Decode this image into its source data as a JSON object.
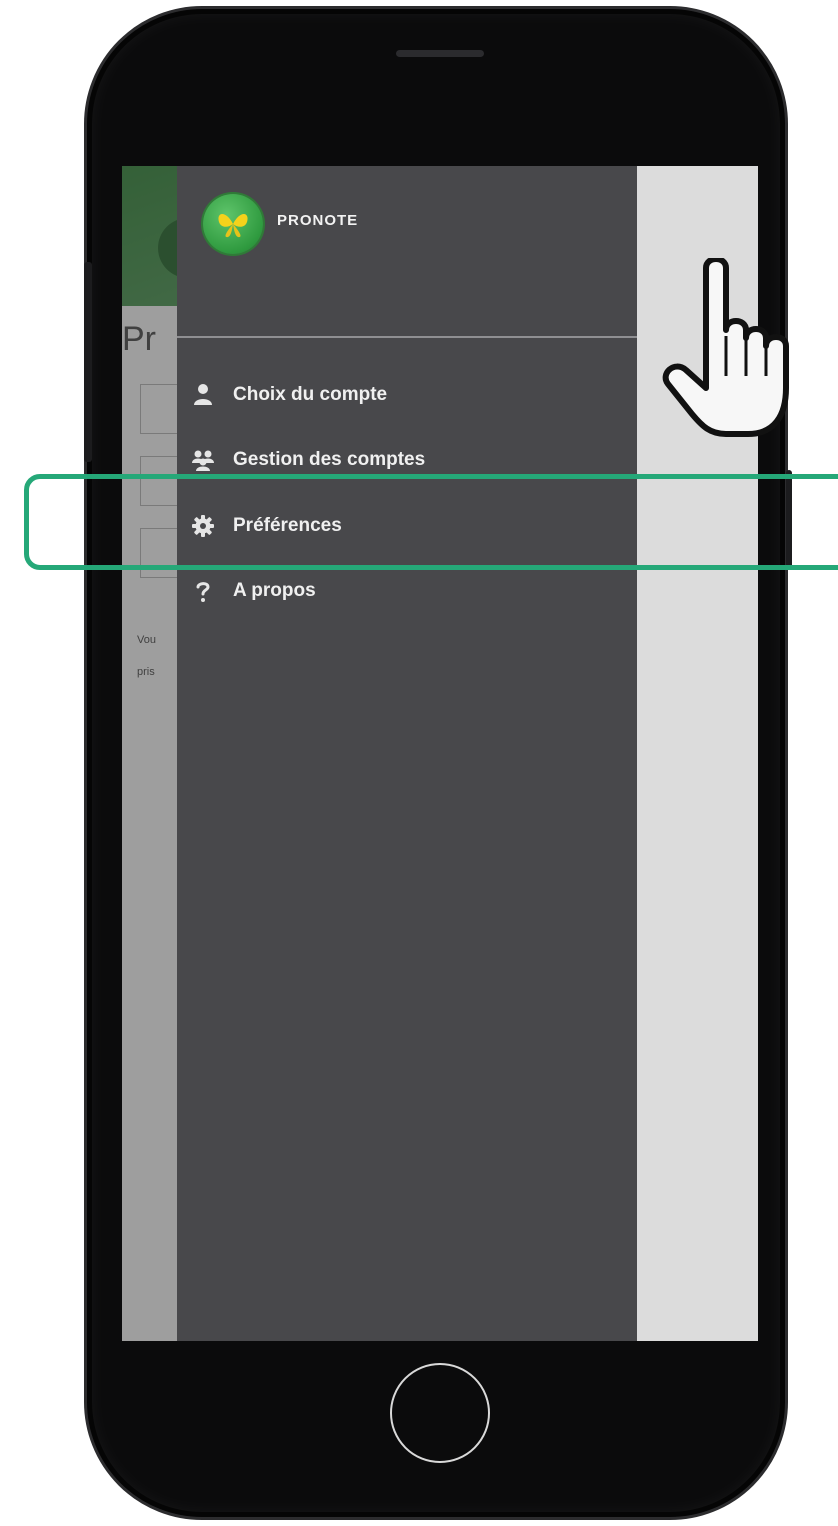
{
  "app": {
    "brand": "PRONOTE",
    "background_title": "Pr",
    "background_text_1": "Vou",
    "background_text_2": "pris"
  },
  "drawer": {
    "items": [
      {
        "label": "Choix du compte",
        "icon": "person-icon"
      },
      {
        "label": "Gestion des comptes",
        "icon": "people-icon"
      },
      {
        "label": "Préférences",
        "icon": "gear-icon"
      },
      {
        "label": "A propos",
        "icon": "question-icon"
      }
    ],
    "highlighted_item": "Préférences"
  },
  "colors": {
    "drawer_bg": "#48484b",
    "highlight_border": "#25a878",
    "brand_green": "#2f9a3f",
    "right_strip": "#dcdcdc"
  },
  "icons": {
    "menu": "hamburger-menu-icon",
    "pointer": "pointing-hand-cursor-icon",
    "logo": "butterfly-logo-icon"
  }
}
